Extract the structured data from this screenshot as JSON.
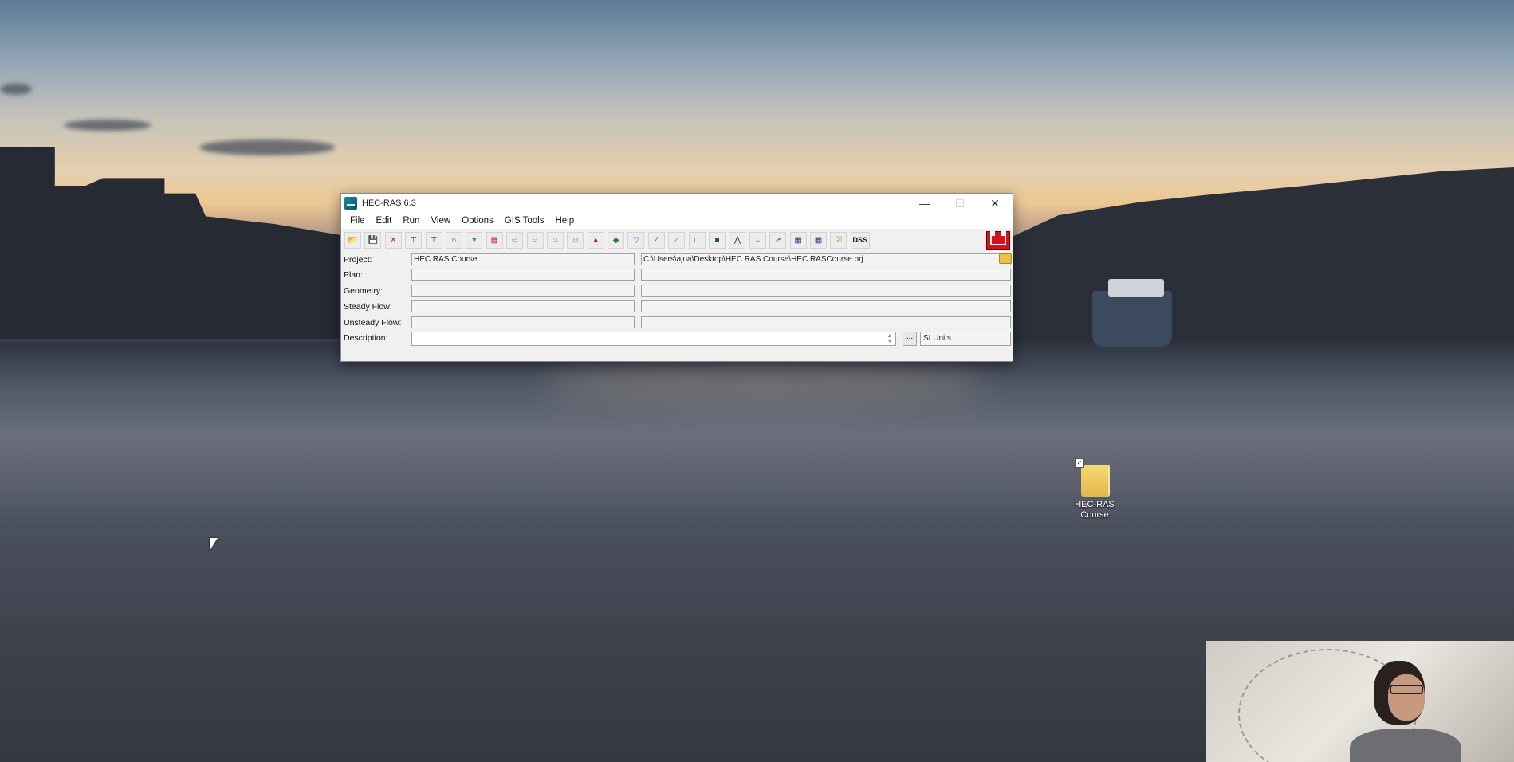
{
  "window": {
    "title": "HEC-RAS 6.3",
    "controls": {
      "minimize": "—",
      "maximize": "☐",
      "close": "✕"
    }
  },
  "menu": [
    "File",
    "Edit",
    "Run",
    "View",
    "Options",
    "GIS Tools",
    "Help"
  ],
  "toolbar": {
    "dss_label": "DSS",
    "icons": [
      "open-project-icon",
      "save-project-icon",
      "edit-geometry-icon",
      "edit-steady-flow-icon",
      "edit-quasi-unsteady-flow-icon",
      "edit-unsteady-flow-icon",
      "edit-sediment-data-icon",
      "edit-water-quality-icon",
      "steady-flow-analysis-icon",
      "unsteady-flow-analysis-icon",
      "sediment-analysis-icon",
      "water-quality-analysis-icon",
      "hydraulic-design-icon",
      "ras-mapper-icon",
      "cross-section-plot-icon",
      "profile-plot-icon",
      "general-profile-plot-icon",
      "rating-curve-icon",
      "xyz-perspective-icon",
      "stage-flow-hydrograph-icon",
      "hydraulic-property-plot-icon",
      "velocity-distribution-icon",
      "detailed-output-table-icon",
      "profile-summary-table-icon",
      "summary-errors-icon"
    ]
  },
  "fields": {
    "project": {
      "label": "Project:",
      "title": "HEC RAS Course",
      "file": "C:\\Users\\ajua\\Desktop\\HEC RAS Course\\HEC RASCourse.prj"
    },
    "plan": {
      "label": "Plan:"
    },
    "geometry": {
      "label": "Geometry:"
    },
    "steady_flow": {
      "label": "Steady Flow:"
    },
    "unsteady_flow": {
      "label": "Unsteady Flow:"
    },
    "description": {
      "label": "Description:",
      "button": "...",
      "units": "SI Units"
    }
  },
  "desktop": {
    "icon_label_line1": "HEC-RAS",
    "icon_label_line2": "Course",
    "checkbox": "✓"
  },
  "colors": {
    "window_bg": "#f0f0f0",
    "usace_red": "#d8121a",
    "folder_yellow": "#e8c24a"
  }
}
